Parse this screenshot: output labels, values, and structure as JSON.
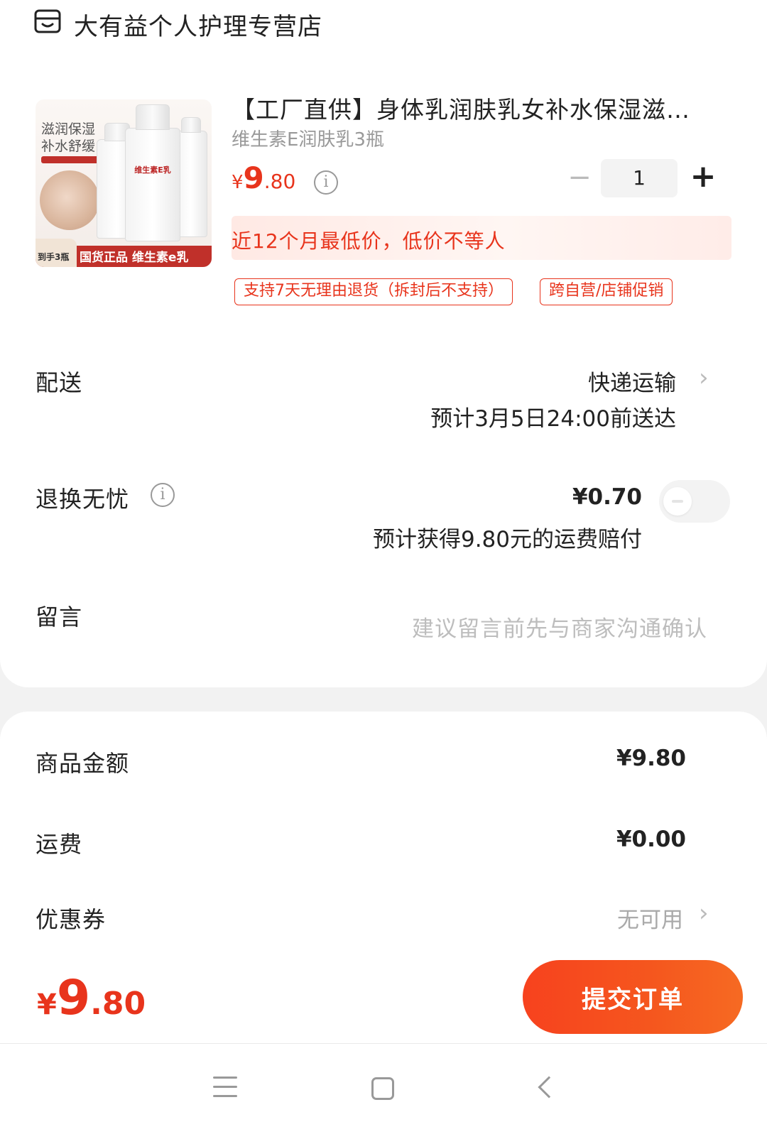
{
  "shop": {
    "icon": "store-icon",
    "name": "大有益个人护理专营店"
  },
  "product": {
    "image": {
      "text_top": "滋润保湿 补水舒缓",
      "bottle_label": "维生素E乳",
      "band_text": "国货正品 维生素e乳",
      "corner_text": "到手3瓶"
    },
    "title": "【工厂直供】身体乳润肤乳女补水保湿滋…",
    "spec": "维生素E润肤乳3瓶",
    "price": {
      "currency": "¥",
      "integer": "9",
      "decimal": ".80"
    },
    "info_icon": "info-icon",
    "quantity": {
      "minus": "−",
      "value": "1",
      "plus": "+"
    },
    "lowest_price_note": "近12个月最低价，低价不等人",
    "tags": [
      "支持7天无理由退货（拆封后不支持）",
      "跨自营/店铺促销"
    ]
  },
  "delivery": {
    "label": "配送",
    "method": "快递运输",
    "eta": "预计3月5日24:00前送达",
    "chevron": "chevron-right-icon"
  },
  "return_insurance": {
    "label": "退换无忧",
    "price": "¥0.70",
    "note": "预计获得9.80元的运费赔付",
    "toggle_on": false
  },
  "message": {
    "label": "留言",
    "placeholder": "建议留言前先与商家沟通确认"
  },
  "summary": {
    "goods_amount_label": "商品金额",
    "goods_amount": "¥9.80",
    "shipping_label": "运费",
    "shipping": "¥0.00",
    "coupon_label": "优惠券",
    "coupon_value": "无可用"
  },
  "bottom_bar": {
    "total": {
      "currency": "¥",
      "integer": "9",
      "decimal": ".80"
    },
    "submit_label": "提交订单"
  },
  "system_nav": {
    "menu": "menu-icon",
    "home": "home-icon",
    "back": "back-icon"
  },
  "colors": {
    "accent": "#e8341c",
    "button": "#f5501e",
    "muted": "#999999"
  }
}
